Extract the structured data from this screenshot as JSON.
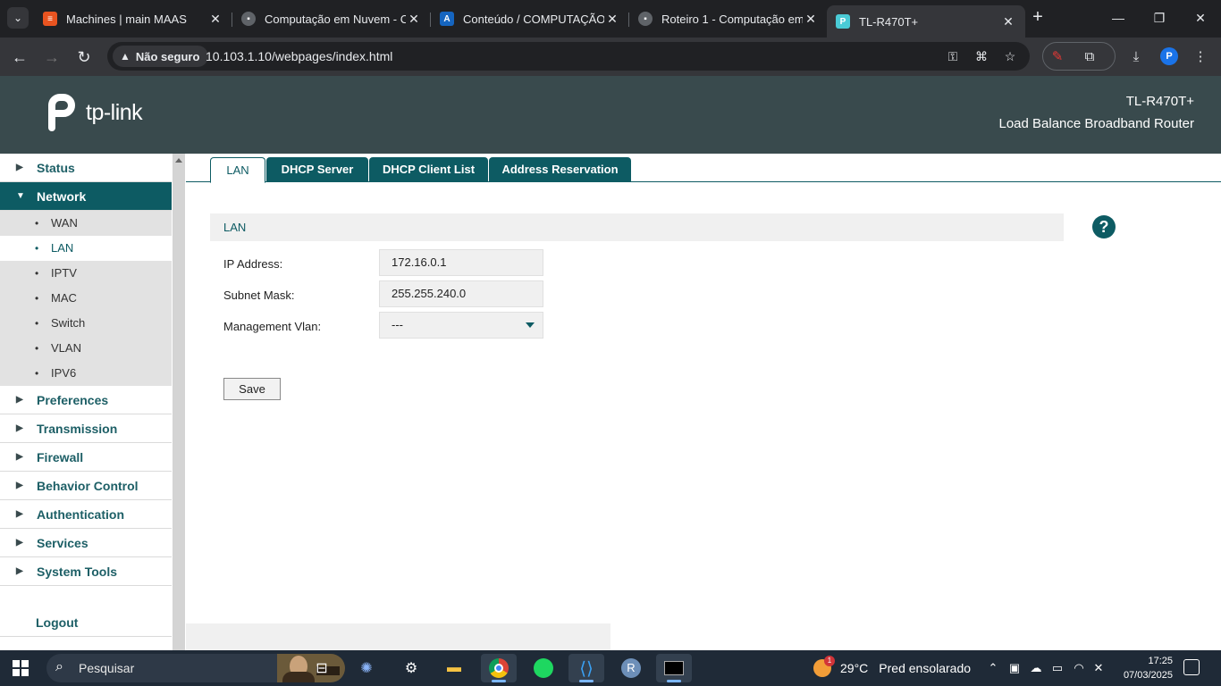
{
  "browser": {
    "tabs": [
      {
        "title": "Machines | main MAAS",
        "favicon": "maas-icon",
        "color": "#e95420"
      },
      {
        "title": "Computação em Nuvem - C",
        "favicon": "book-icon",
        "color": "#5f6368"
      },
      {
        "title": "Conteúdo / COMPUTAÇÃO E",
        "favicon": "avaloq-icon",
        "color": "#1565c0"
      },
      {
        "title": "Roteiro 1 - Computação em",
        "favicon": "book-icon",
        "color": "#5f6368"
      },
      {
        "title": "TL-R470T+",
        "favicon": "tplink-icon",
        "color": "#4acbd6",
        "active": true
      }
    ],
    "security_label": "Não seguro",
    "url": "10.103.1.10/webpages/index.html",
    "profile_initial": "P"
  },
  "router": {
    "brand": "tp-link",
    "model": "TL-R470T+",
    "description": "Load Balance Broadband Router",
    "sidebar": {
      "items": [
        {
          "label": "Status",
          "expanded": false
        },
        {
          "label": "Network",
          "expanded": true
        },
        {
          "label": "Preferences",
          "expanded": false
        },
        {
          "label": "Transmission",
          "expanded": false
        },
        {
          "label": "Firewall",
          "expanded": false
        },
        {
          "label": "Behavior Control",
          "expanded": false
        },
        {
          "label": "Authentication",
          "expanded": false
        },
        {
          "label": "Services",
          "expanded": false
        },
        {
          "label": "System Tools",
          "expanded": false
        }
      ],
      "network_sub": [
        "WAN",
        "LAN",
        "IPTV",
        "MAC",
        "Switch",
        "VLAN",
        "IPV6"
      ],
      "active_sub": "LAN",
      "logout": "Logout"
    },
    "tabs": [
      "LAN",
      "DHCP Server",
      "DHCP Client List",
      "Address Reservation"
    ],
    "active_tab": "LAN",
    "section_title": "LAN",
    "help_symbol": "?",
    "form": {
      "ip_label": "IP Address:",
      "ip_value": "172.16.0.1",
      "mask_label": "Subnet Mask:",
      "mask_value": "255.255.240.0",
      "vlan_label": "Management Vlan:",
      "vlan_value": "---",
      "save_label": "Save"
    },
    "colors": {
      "header": "#394a4d",
      "accent": "#0d5b63"
    }
  },
  "taskbar": {
    "search_placeholder": "Pesquisar",
    "weather_temp": "29°C",
    "weather_text": "Pred ensolarado",
    "weather_badge": "1",
    "time": "17:25",
    "date": "07/03/2025"
  }
}
